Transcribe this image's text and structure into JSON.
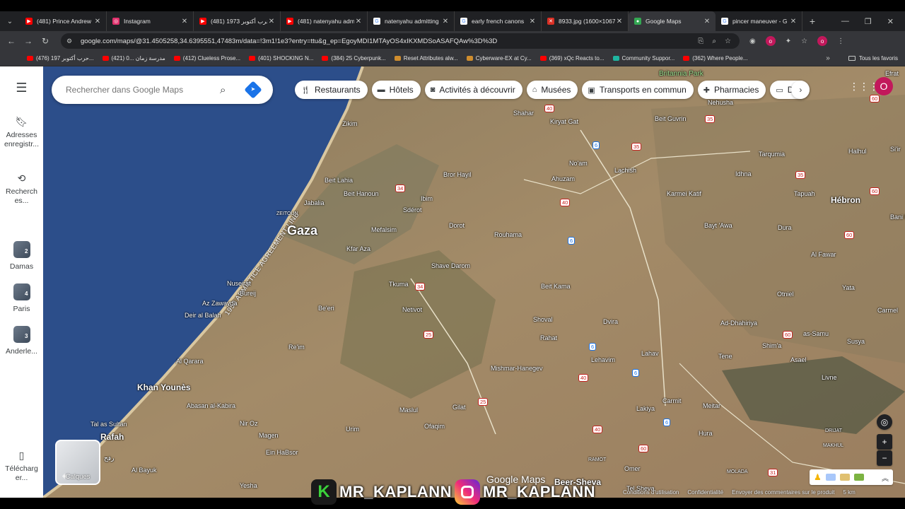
{
  "browser": {
    "tabs": [
      {
        "title": "(481) Prince Andrew",
        "favicon": "youtube-icon",
        "color": "#ff0000"
      },
      {
        "title": "Instagram",
        "favicon": "instagram-icon",
        "color": "#e1306c"
      },
      {
        "title": "(481) حرب أكتوبر 1973",
        "favicon": "youtube-icon",
        "color": "#ff0000"
      },
      {
        "title": "(481) natenyahu adm",
        "favicon": "youtube-icon",
        "color": "#ff0000"
      },
      {
        "title": "natenyahu admitting",
        "favicon": "google-icon",
        "color": "#4285f4"
      },
      {
        "title": "early french canons",
        "favicon": "google-icon",
        "color": "#4285f4"
      },
      {
        "title": "8933.jpg (1600×1067",
        "favicon": "image-icon",
        "color": "#d93025"
      },
      {
        "title": "Google Maps",
        "favicon": "maps-icon",
        "color": "#34a853",
        "active": true
      },
      {
        "title": "pincer maneuver - G",
        "favicon": "google-icon",
        "color": "#4285f4"
      }
    ],
    "url": "google.com/maps/@31.4505258,34.6395551,47483m/data=!3m1!1e3?entry=ttu&g_ep=EgoyMDI1MTAyOS4xIKXMDSoASAFQAw%3D%3D",
    "bookmarks": [
      {
        "label": "(476) حرب أكتوبر 197...",
        "type": "youtube"
      },
      {
        "label": "(421) مدرسة زمان ...0",
        "type": "youtube"
      },
      {
        "label": "(412) Clueless Prose...",
        "type": "youtube"
      },
      {
        "label": "(401) SHOCKING N...",
        "type": "youtube"
      },
      {
        "label": "(384) 25 Cyberpunk...",
        "type": "youtube"
      },
      {
        "label": "Reset Attributes alw...",
        "type": "game"
      },
      {
        "label": "Cyberware-EX at Cy...",
        "type": "game"
      },
      {
        "label": "(369) xQc Reacts to...",
        "type": "youtube"
      },
      {
        "label": "Community Suppor...",
        "type": "community"
      },
      {
        "label": "(362) Where People...",
        "type": "youtube"
      }
    ],
    "all_bookmarks": "Tous les favoris"
  },
  "maps": {
    "search_placeholder": "Rechercher dans Google Maps",
    "rail": {
      "saved": "Adresses enregistr...",
      "recent": "Recherch es...",
      "places": [
        {
          "label": "Damas",
          "num": "2"
        },
        {
          "label": "Paris",
          "num": "4"
        },
        {
          "label": "Anderle...",
          "num": "3"
        }
      ],
      "download": "Télécharg er..."
    },
    "chips": [
      {
        "label": "Restaurants",
        "icon": "fork-knife-icon"
      },
      {
        "label": "Hôtels",
        "icon": "bed-icon"
      },
      {
        "label": "Activités à découvrir",
        "icon": "camera-icon"
      },
      {
        "label": "Musées",
        "icon": "museum-icon"
      },
      {
        "label": "Transports en commun",
        "icon": "bus-icon"
      },
      {
        "label": "Pharmacies",
        "icon": "pharmacy-icon"
      },
      {
        "label": "DAB",
        "icon": "atm-icon"
      }
    ],
    "avatar_letter": "O",
    "layers_label": "Calques",
    "armistice_line": "1950 ARMISTICE AGREEMENT LINE",
    "logo_text": "Google Maps",
    "footer": [
      "Conditions d'utilisation",
      "Confidentialité",
      "Envoyer des commentaires sur le produit",
      "5 km"
    ],
    "places": {
      "gaza": "Gaza",
      "zikim": "Zikim",
      "beit_lahia": "Beit Lahia",
      "beit_hanoun": "Beit Hanoun",
      "jabalia": "Jabalia",
      "zeitoun": "ZEITOUN",
      "nuseirat": "Nuseirat",
      "bureij": "Bureij",
      "az_zawayda": "Az Zawayda",
      "deir_al_balah": "Deir al Balah",
      "al_qarara": "Al Qarara",
      "khan_younis": "Khan Younès",
      "abasan": "Abasan al-Kabira",
      "tal_as_sultan": "Tal as Sultan",
      "rafah": "Rafah",
      "rafah_ar": "رفح",
      "al_bayuk": "Al Bayuk",
      "yesha": "Yesha",
      "shahar": "Shahar",
      "kiryat_gat": "Kiryat Gat",
      "noam": "No'am",
      "lachish": "Lachish",
      "beit_guvrin": "Beit Guvrin",
      "nehusha": "Nehusha",
      "britannia": "Britannia Park",
      "bror_hayil": "Bror Hayil",
      "ahuzam": "Ahuzam",
      "ibim": "Ibim",
      "sderot": "Sdérot",
      "dorot": "Dorot",
      "mefalsim": "Mefalsim",
      "rouhama": "Rouhama",
      "kfar_aza": "Kfar Aza",
      "shave_darom": "Shave Darom",
      "tkuma": "Tkuma",
      "beit_kama": "Beit Kama",
      "netivot": "Netivot",
      "beeri": "Be'eri",
      "reim": "Re'im",
      "shoval": "Shoval",
      "rahat": "Rahat",
      "dvira": "Dvira",
      "lahav": "Lahav",
      "lehavim": "Lehavim",
      "mishmar_hanegev": "Mishmar-Hanegev",
      "maslul": "Maslul",
      "gilat": "Gilat",
      "ofaqim": "Ofaqim",
      "urim": "Urim",
      "nir_oz": "Nir Oz",
      "magen": "Magen",
      "ein_habsor": "Ein HaBsor",
      "beer_sheva": "Beer-Sheva",
      "omer": "Omer",
      "ramot": "RAMOT",
      "tel_sheva": "Tel Sheva",
      "lakiya": "Lakiya",
      "carmit": "Carmit",
      "meitar": "Meitar",
      "hura": "Hura",
      "hebron": "Hébron",
      "idhna": "Idhna",
      "tarqumia": "Tarqumia",
      "halhul": "Halhul",
      "sair": "Si'ir",
      "bani_n": "Bani N",
      "efrat": "Efrat",
      "karmei_katif": "Karmei Katif",
      "tapuah": "Tapuah",
      "bayt_awa": "Bayt 'Awa",
      "dura": "Dura",
      "al_fawar": "Al Fawar",
      "otniel": "Otniel",
      "yata": "Yata",
      "carmel": "Carmel",
      "ad_dhahiriya": "Ad-Dhahiriya",
      "as_samu": "as-Samu",
      "susya": "Susya",
      "shima": "Shim'a",
      "tene": "Tene",
      "asael": "Asael",
      "livne": "Livne",
      "drijat": "DRIJAT",
      "makhul": "MAKHUL",
      "molada": "MOLADA"
    }
  },
  "watermark": {
    "handle1": "MR_KAPLANN",
    "handle2": "MR_KAPLANN"
  },
  "colors": {
    "sea": "#2c4e8a",
    "land": "#a08a6a",
    "accent": "#1a73e8",
    "avatar": "#c2185b"
  }
}
